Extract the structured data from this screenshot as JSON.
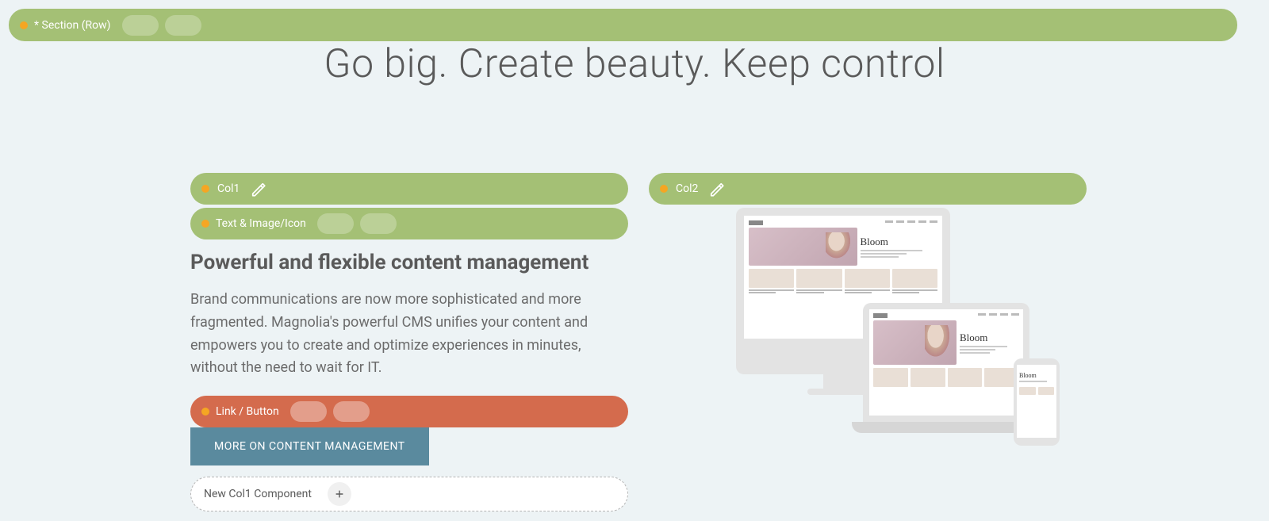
{
  "section": {
    "label": "* Section (Row)"
  },
  "hero": {
    "title": "Go big. Create beauty. Keep control"
  },
  "col1": {
    "label": "Col1",
    "component_label": "Text & Image/Icon",
    "heading": "Powerful and flexible content management",
    "body": "Brand communications are now more sophisticated and more fragmented. Magnolia's powerful CMS unifies your content and empowers you to create and optimize experiences in minutes, without the need to wait for IT.",
    "link_component_label": "Link / Button",
    "cta_label": "MORE ON CONTENT MANAGEMENT",
    "add_label": "New Col1 Component"
  },
  "col2": {
    "label": "Col2",
    "mock_brand": "Bloom"
  },
  "colors": {
    "bar_green": "#a4c075",
    "bar_orange": "#d46b4d",
    "cta": "#5a8a9e",
    "dot": "#f5a623"
  }
}
